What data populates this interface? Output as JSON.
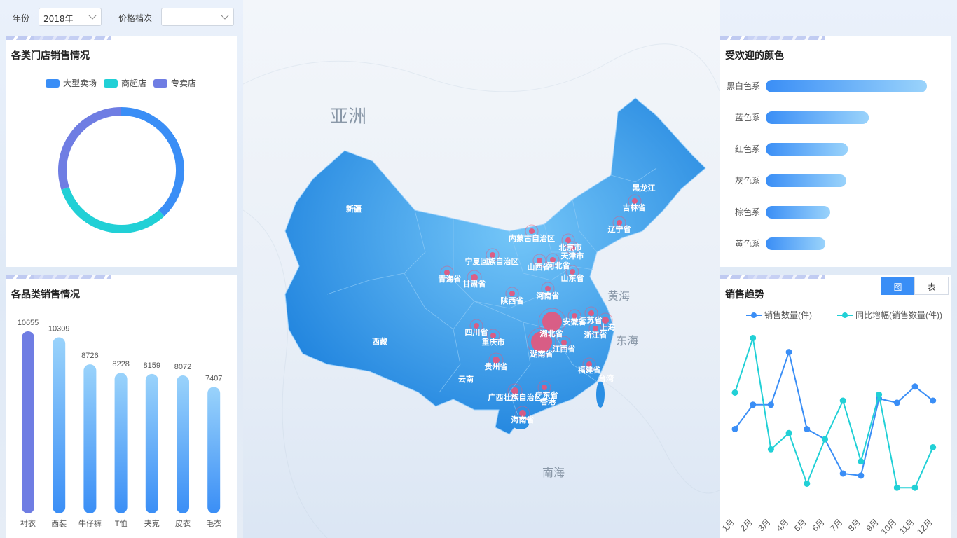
{
  "filters": {
    "year_label": "年份",
    "year_value": "2018年",
    "price_label": "价格档次",
    "price_value": ""
  },
  "store_panel": {
    "title": "各类门店销售情况"
  },
  "category_panel": {
    "title": "各品类销售情况"
  },
  "color_panel": {
    "title": "受欢迎的颜色"
  },
  "trend_panel": {
    "title": "销售趋势",
    "tab_chart": "图",
    "tab_table": "表"
  },
  "map": {
    "big_labels": [
      "亚洲",
      "黄海",
      "东海",
      "南海"
    ],
    "provinces": [
      "黑龙江",
      "吉林省",
      "辽宁省",
      "内蒙古自治区",
      "北京市",
      "天津市",
      "山西省",
      "河北省",
      "山东省",
      "新疆",
      "宁夏回族自治区",
      "青海省",
      "甘肃省",
      "陕西省",
      "河南省",
      "安徽省",
      "江苏省",
      "上海",
      "浙江省",
      "湖北省",
      "湖南省",
      "江西省",
      "四川省",
      "重庆市",
      "贵州省",
      "西藏",
      "云南",
      "福建省",
      "台湾",
      "广西壮族自治区",
      "广东省",
      "香港",
      "海南省"
    ]
  },
  "colors": {
    "accent": "#3a8ef6",
    "teal": "#21d0d6",
    "purple": "#6f7de3",
    "marker": "#e8557a"
  },
  "chart_data": [
    {
      "type": "pie",
      "subtype": "donut",
      "legend": [
        "大型卖场",
        "商超店",
        "专卖店"
      ],
      "values": [
        38,
        32,
        30
      ],
      "legend_position": "top"
    },
    {
      "type": "bar",
      "categories": [
        "衬衣",
        "西装",
        "牛仔裤",
        "T恤",
        "夹克",
        "皮衣",
        "毛衣"
      ],
      "values": [
        10655,
        10309,
        8726,
        8228,
        8159,
        8072,
        7407
      ]
    },
    {
      "type": "bar",
      "orientation": "horizontal",
      "categories": [
        "黑白色系",
        "蓝色系",
        "红色系",
        "灰色系",
        "棕色系",
        "黄色系"
      ],
      "values": [
        100,
        64,
        51,
        50,
        40,
        37
      ]
    },
    {
      "type": "line",
      "categories": [
        "1月",
        "2月",
        "3月",
        "4月",
        "5月",
        "6月",
        "7月",
        "8月",
        "9月",
        "10月",
        "11月",
        "12月"
      ],
      "legend_position": "top",
      "series": [
        {
          "name": "销售数量(件)",
          "values": [
            40,
            52,
            52,
            78,
            40,
            35,
            18,
            17,
            55,
            53,
            61,
            54
          ]
        },
        {
          "name": "同比增幅(销售数量(件))",
          "values": [
            58,
            85,
            30,
            38,
            13,
            35,
            54,
            24,
            57,
            11,
            11,
            31
          ]
        }
      ]
    }
  ]
}
